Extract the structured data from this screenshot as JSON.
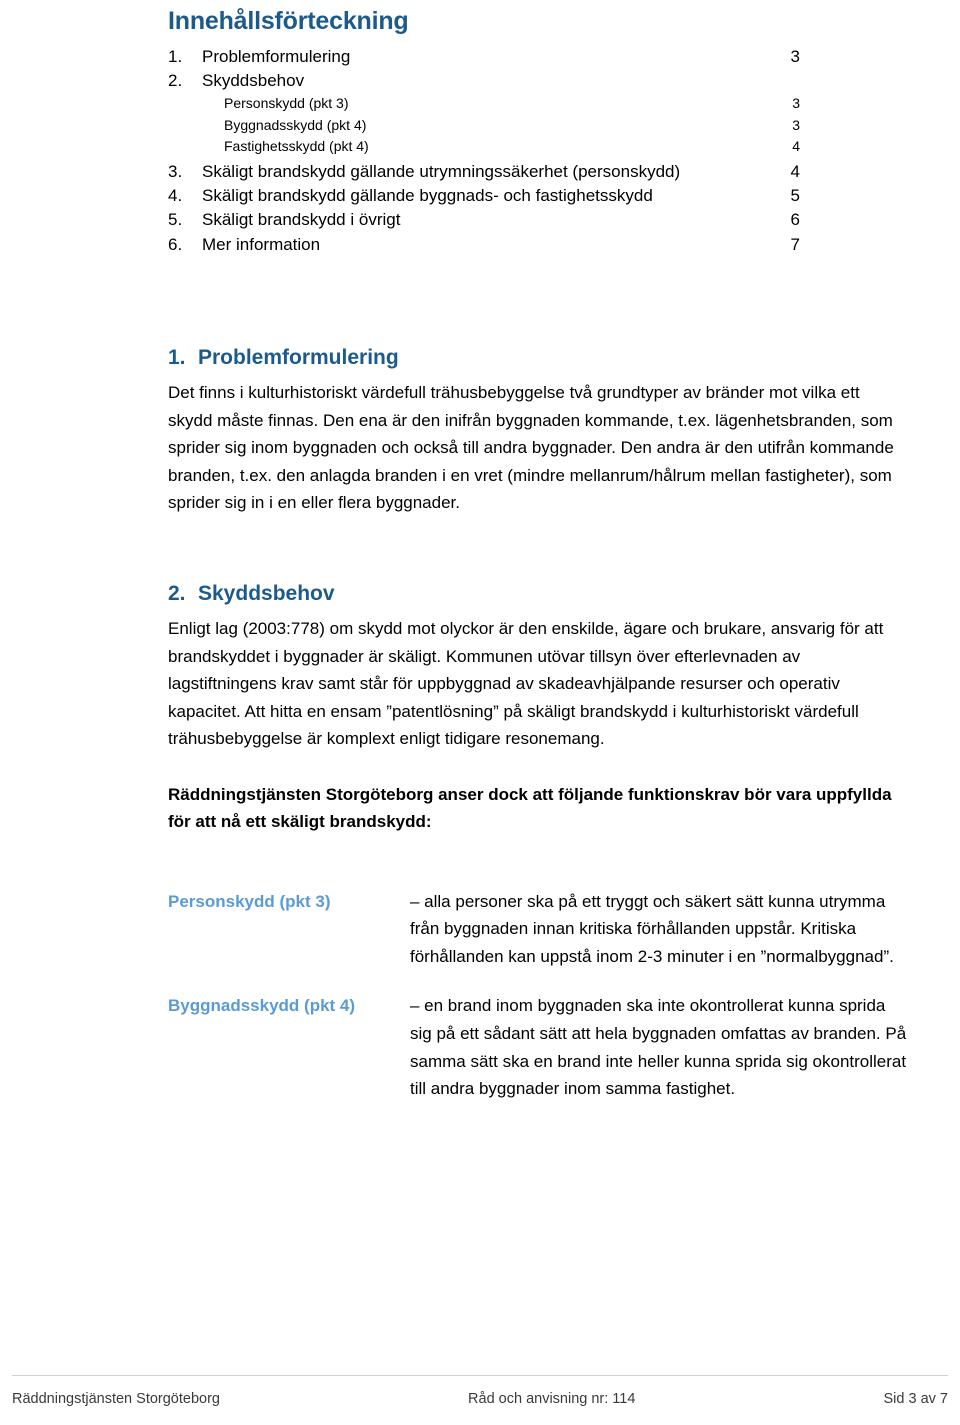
{
  "toc": {
    "title": "Innehållsförteckning",
    "entries": [
      {
        "num": "1.",
        "label": "Problemformulering",
        "page": "3",
        "level": 1
      },
      {
        "num": "2.",
        "label": "Skyddsbehov",
        "page": "",
        "level": 1
      },
      {
        "num": "",
        "label": "Personskydd (pkt 3)",
        "page": "3",
        "level": 2
      },
      {
        "num": "",
        "label": "Byggnadsskydd (pkt 4)",
        "page": "3",
        "level": 2
      },
      {
        "num": "",
        "label": "Fastighetsskydd (pkt 4)",
        "page": "4",
        "level": 2
      },
      {
        "num": "3.",
        "label": "Skäligt brandskydd gällande utrymningssäkerhet (personskydd)",
        "page": "4",
        "level": 1
      },
      {
        "num": "4.",
        "label": "Skäligt brandskydd gällande byggnads- och fastighetsskydd",
        "page": "5",
        "level": 1
      },
      {
        "num": "5.",
        "label": "Skäligt brandskydd i övrigt",
        "page": "6",
        "level": 1
      },
      {
        "num": "6.",
        "label": "Mer information",
        "page": "7",
        "level": 1
      }
    ]
  },
  "sections": {
    "problem": {
      "num": "1.",
      "title": "Problemformulering",
      "paragraph": "Det finns i kulturhistoriskt värdefull trähusbebyggelse två grundtyper av bränder mot vilka ett skydd måste finnas. Den ena är den inifrån byggnaden kommande, t.ex. lägenhetsbranden, som sprider sig inom byggnaden och också till andra byggnader. Den andra är den utifrån kommande branden, t.ex. den anlagda branden i en vret (mindre mellanrum/hålrum mellan fastigheter), som sprider sig in i en eller flera byggnader."
    },
    "skyddsbehov": {
      "num": "2.",
      "title": "Skyddsbehov",
      "paragraph1": "Enligt lag (2003:778) om skydd mot olyckor är den enskilde, ägare och brukare, ansvarig för att brandskyddet i byggnader är skäligt. Kommunen utövar tillsyn över efterlevnaden av lagstiftningens krav samt står för uppbyggnad av skadeavhjälpande resurser och operativ kapacitet. Att hitta en ensam ”patentlösning” på skäligt brandskydd i kulturhistoriskt värdefull trähusbebyggelse är komplext enligt tidigare resonemang.",
      "paragraph2": "Räddningstjänsten Storgöteborg anser dock att följande funktionskrav bör vara uppfyllda för att nå ett skäligt brandskydd:",
      "definitions": [
        {
          "term": "Personskydd (pkt 3)",
          "text": "– alla personer ska på ett tryggt och säkert sätt kunna utrymma från byggnaden innan kritiska förhållanden uppstår. Kritiska förhållanden kan uppstå inom 2-3 minuter i en ”normalbyggnad”."
        },
        {
          "term": "Byggnadsskydd (pkt 4)",
          "text": "– en brand inom byggnaden ska inte okontrollerat kunna sprida sig på ett sådant sätt att hela byggnaden omfattas av branden. På samma sätt ska en brand inte heller kunna sprida sig okontrollerat till andra byggnader inom samma fastighet."
        }
      ]
    }
  },
  "footer": {
    "left": "Räddningstjänsten Storgöteborg",
    "center": "Råd och anvisning nr: 114",
    "right": "Sid 3 av 7"
  },
  "colors": {
    "heading_blue": "#1d5a8c",
    "term_blue": "#5b9bd5",
    "footer_rule": "#d0cece"
  }
}
